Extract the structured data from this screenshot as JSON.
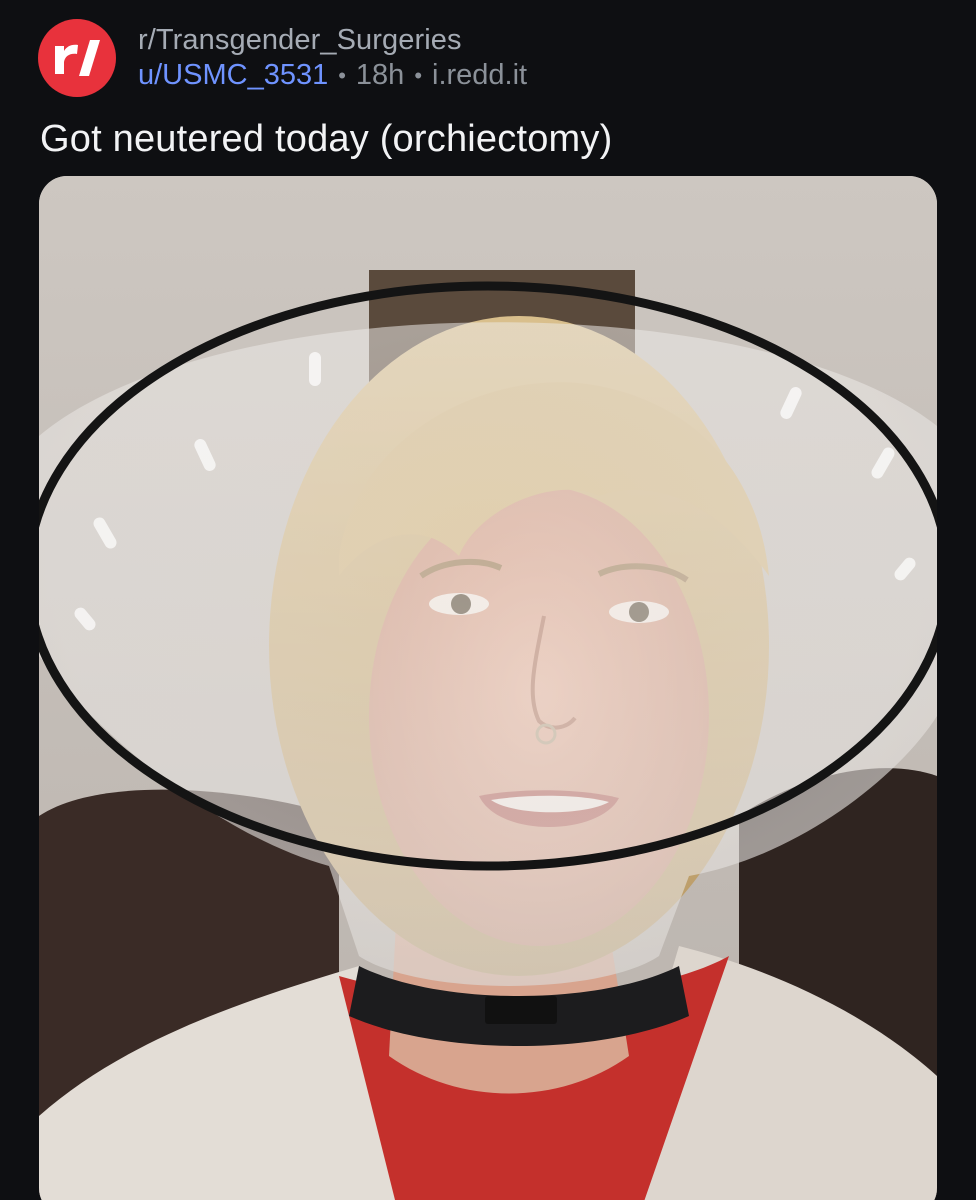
{
  "post": {
    "subreddit": "r/Transgender_Surgeries",
    "username": "u/USMC_3531",
    "separator": "•",
    "age": "18h",
    "domain": "i.redd.it",
    "title": "Got neutered today (orchiectomy)"
  },
  "icons": {
    "subreddit_avatar": "reddit-r-slash-icon"
  },
  "colors": {
    "background": "#0e0f12",
    "avatar": "#e8323c",
    "username": "#6f93ff",
    "meta": "#8b9199",
    "title": "#f2f3f5"
  }
}
